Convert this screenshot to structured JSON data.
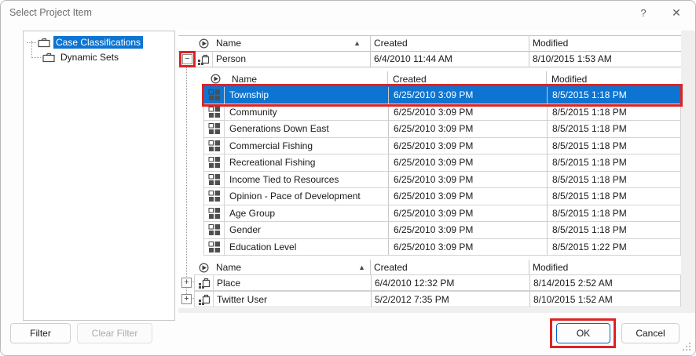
{
  "window": {
    "title": "Select Project Item",
    "help_glyph": "?",
    "close_glyph": "✕"
  },
  "colors": {
    "selection_blue": "#0d74d1",
    "annotation_red": "#de2323",
    "ok_button_border": "#0067c0"
  },
  "glyphs": {
    "sort_ascending": "▲",
    "collapse": "−",
    "expand": "+"
  },
  "tree": {
    "items": [
      {
        "label": "Case Classifications",
        "selected": true
      },
      {
        "label": "Dynamic Sets",
        "selected": false
      }
    ]
  },
  "columns": {
    "name": "Name",
    "created": "Created",
    "modified": "Modified"
  },
  "top": {
    "person": {
      "name": "Person",
      "created": "6/4/2010 11:44 AM",
      "modified": "8/10/2015 1:53 AM"
    }
  },
  "nested": {
    "rows": [
      {
        "name": "Township",
        "created": "6/25/2010 3:09 PM",
        "modified": "8/5/2015 1:18 PM",
        "selected": true
      },
      {
        "name": "Community",
        "created": "6/25/2010 3:09 PM",
        "modified": "8/5/2015 1:18 PM",
        "selected": false
      },
      {
        "name": "Generations Down East",
        "created": "6/25/2010 3:09 PM",
        "modified": "8/5/2015 1:18 PM",
        "selected": false
      },
      {
        "name": "Commercial Fishing",
        "created": "6/25/2010 3:09 PM",
        "modified": "8/5/2015 1:18 PM",
        "selected": false
      },
      {
        "name": "Recreational Fishing",
        "created": "6/25/2010 3:09 PM",
        "modified": "8/5/2015 1:18 PM",
        "selected": false
      },
      {
        "name": "Income Tied to Resources",
        "created": "6/25/2010 3:09 PM",
        "modified": "8/5/2015 1:18 PM",
        "selected": false
      },
      {
        "name": "Opinion - Pace of Development",
        "created": "6/25/2010 3:09 PM",
        "modified": "8/5/2015 1:18 PM",
        "selected": false
      },
      {
        "name": "Age Group",
        "created": "6/25/2010 3:09 PM",
        "modified": "8/5/2015 1:18 PM",
        "selected": false
      },
      {
        "name": "Gender",
        "created": "6/25/2010 3:09 PM",
        "modified": "8/5/2015 1:18 PM",
        "selected": false
      },
      {
        "name": "Education Level",
        "created": "6/25/2010 3:09 PM",
        "modified": "8/5/2015 1:22 PM",
        "selected": false
      }
    ]
  },
  "bottom": {
    "rows": [
      {
        "name": "Place",
        "created": "6/4/2010 12:32 PM",
        "modified": "8/14/2015 2:52 AM"
      },
      {
        "name": "Twitter User",
        "created": "5/2/2012 7:35 PM",
        "modified": "8/10/2015 1:52 AM"
      }
    ]
  },
  "footer": {
    "filter_label": "Filter",
    "clear_filter_label": "Clear Filter",
    "ok_label": "OK",
    "cancel_label": "Cancel"
  }
}
